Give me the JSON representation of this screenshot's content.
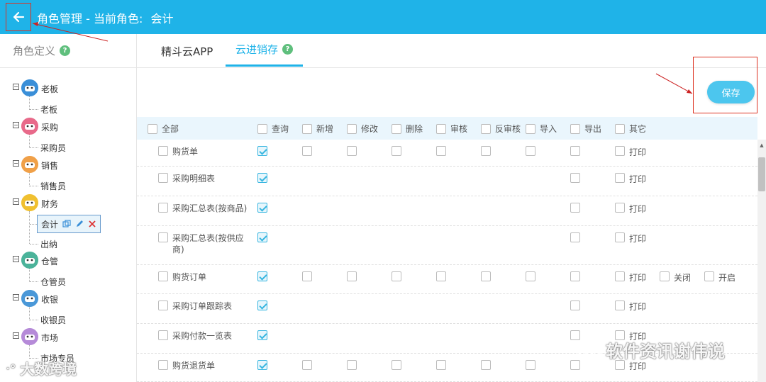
{
  "header": {
    "back_icon": "arrow-left-icon",
    "title_prefix": "角色管理 - 当前角色:",
    "title_role": "会计",
    "bg_color": "#1fb3e8"
  },
  "sidebar": {
    "title": "角色定义",
    "help_icon": "?",
    "groups": [
      {
        "label": "老板",
        "children": [
          "老板"
        ],
        "avatar_color": "#3a8fd8"
      },
      {
        "label": "采购",
        "children": [
          "采购员"
        ],
        "avatar_color": "#e86a8a"
      },
      {
        "label": "销售",
        "children": [
          "销售员"
        ],
        "avatar_color": "#f0a048"
      },
      {
        "label": "财务",
        "children": [
          "会计",
          "出纳"
        ],
        "avatar_color": "#f0c030"
      },
      {
        "label": "仓管",
        "children": [
          "仓管员"
        ],
        "avatar_color": "#4bb39a"
      },
      {
        "label": "收银",
        "children": [
          "收银员"
        ],
        "avatar_color": "#4a98d8"
      },
      {
        "label": "市场",
        "children": [
          "市场专员"
        ],
        "avatar_color": "#b58ad8"
      }
    ],
    "selected_child": "会计"
  },
  "tabs": [
    {
      "label": "精斗云APP",
      "active": false
    },
    {
      "label": "云进销存",
      "active": true
    }
  ],
  "tab_help": "?",
  "save_button": "保存",
  "perm_header": [
    "全部",
    "查询",
    "新增",
    "修改",
    "删除",
    "审核",
    "反审核",
    "导入",
    "导出",
    "其它"
  ],
  "rows": [
    {
      "name": "购货单",
      "query": true,
      "std": true,
      "export": true,
      "others": [
        "打印"
      ]
    },
    {
      "name": "采购明细表",
      "query": true,
      "std": false,
      "export": true,
      "others": [
        "打印"
      ]
    },
    {
      "name": "采购汇总表(按商品)",
      "query": true,
      "std": false,
      "export": true,
      "others": [
        "打印"
      ]
    },
    {
      "name": "采购汇总表(按供应商)",
      "query": true,
      "std": false,
      "export": true,
      "others": [
        "打印"
      ]
    },
    {
      "name": "购货订单",
      "query": true,
      "std": true,
      "export": true,
      "others": [
        "打印",
        "关闭",
        "开启"
      ]
    },
    {
      "name": "采购订单跟踪表",
      "query": true,
      "std": false,
      "export": true,
      "others": [
        "打印"
      ]
    },
    {
      "name": "采购付款一览表",
      "query": true,
      "std": false,
      "export": true,
      "others": [
        "打印"
      ]
    },
    {
      "name": "购货退货单",
      "query": true,
      "std": true,
      "export": true,
      "others": [
        "打印"
      ]
    }
  ],
  "watermarks": {
    "bottom_left": "大数跨境",
    "bottom_right": "软件资讯谢伟说"
  }
}
